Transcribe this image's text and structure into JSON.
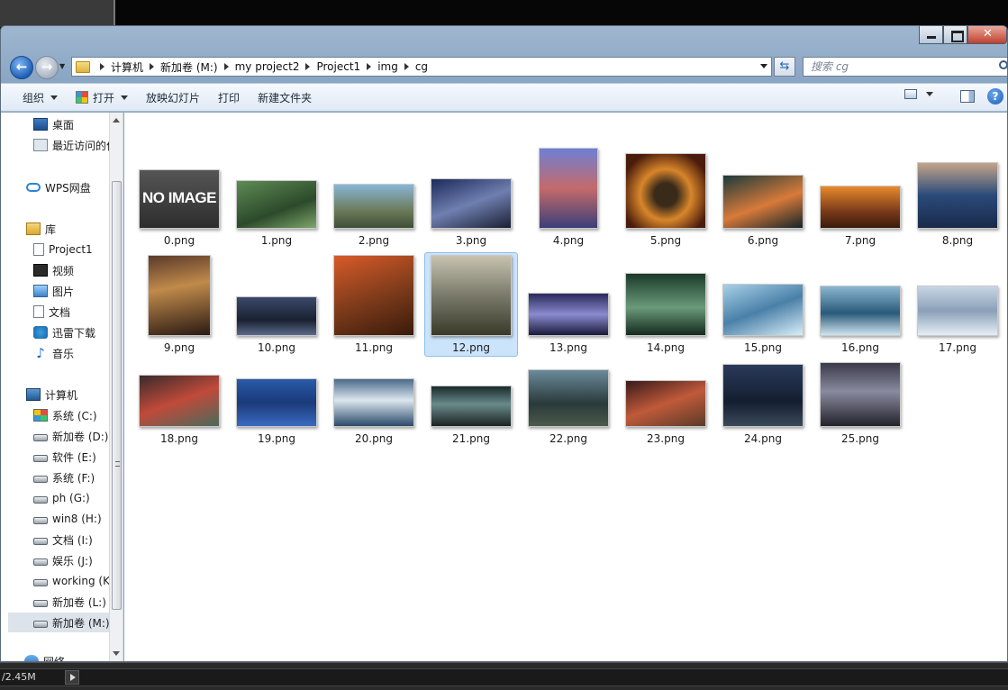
{
  "window": {
    "address": [
      "计算机",
      "新加卷 (M:)",
      "my project2",
      "Project1",
      "img",
      "cg"
    ],
    "search_placeholder": "搜索 cg"
  },
  "toolbar": {
    "organize": "组织",
    "open": "打开",
    "slideshow": "放映幻灯片",
    "print": "打印",
    "new_folder": "新建文件夹"
  },
  "sidebar": {
    "items": [
      {
        "label": "桌面",
        "icon": "desktop-icon"
      },
      {
        "label": "最近访问的位置",
        "icon": "recent-places-icon"
      },
      {
        "label": "WPS网盘",
        "icon": "cloud-icon"
      },
      {
        "label": "库",
        "icon": "library-icon"
      },
      {
        "label": "Project1",
        "icon": "document-icon"
      },
      {
        "label": "视频",
        "icon": "video-icon"
      },
      {
        "label": "图片",
        "icon": "pictures-icon"
      },
      {
        "label": "文档",
        "icon": "documents-icon"
      },
      {
        "label": "迅雷下载",
        "icon": "download-icon"
      },
      {
        "label": "音乐",
        "icon": "music-icon"
      },
      {
        "label": "计算机",
        "icon": "computer-icon"
      },
      {
        "label": "系统 (C:)",
        "icon": "system-drive-icon"
      },
      {
        "label": "新加卷 (D:)",
        "icon": "drive-icon"
      },
      {
        "label": "软件 (E:)",
        "icon": "drive-icon"
      },
      {
        "label": "系统 (F:)",
        "icon": "drive-icon"
      },
      {
        "label": "ph (G:)",
        "icon": "drive-icon"
      },
      {
        "label": "win8 (H:)",
        "icon": "drive-icon"
      },
      {
        "label": "文档 (I:)",
        "icon": "drive-icon"
      },
      {
        "label": "娱乐 (J:)",
        "icon": "drive-icon"
      },
      {
        "label": "working (K:)",
        "icon": "drive-icon"
      },
      {
        "label": "新加卷 (L:)",
        "icon": "drive-icon"
      },
      {
        "label": "新加卷 (M:)",
        "icon": "drive-icon"
      },
      {
        "label": "网络",
        "icon": "network-icon"
      }
    ]
  },
  "files": [
    {
      "name": "0.png",
      "noimage": "NO IMAGE"
    },
    {
      "name": "1.png"
    },
    {
      "name": "2.png"
    },
    {
      "name": "3.png"
    },
    {
      "name": "4.png"
    },
    {
      "name": "5.png"
    },
    {
      "name": "6.png"
    },
    {
      "name": "7.png"
    },
    {
      "name": "8.png"
    },
    {
      "name": "9.png"
    },
    {
      "name": "10.png"
    },
    {
      "name": "11.png"
    },
    {
      "name": "12.png"
    },
    {
      "name": "13.png"
    },
    {
      "name": "14.png"
    },
    {
      "name": "15.png"
    },
    {
      "name": "16.png"
    },
    {
      "name": "17.png"
    },
    {
      "name": "18.png"
    },
    {
      "name": "19.png"
    },
    {
      "name": "20.png"
    },
    {
      "name": "21.png"
    },
    {
      "name": "22.png"
    },
    {
      "name": "23.png"
    },
    {
      "name": "24.png"
    },
    {
      "name": "25.png"
    }
  ],
  "status": {
    "size": "/2.45M"
  },
  "colors": {
    "selection": "#cce4fb",
    "accent": "#1f5fb8"
  }
}
